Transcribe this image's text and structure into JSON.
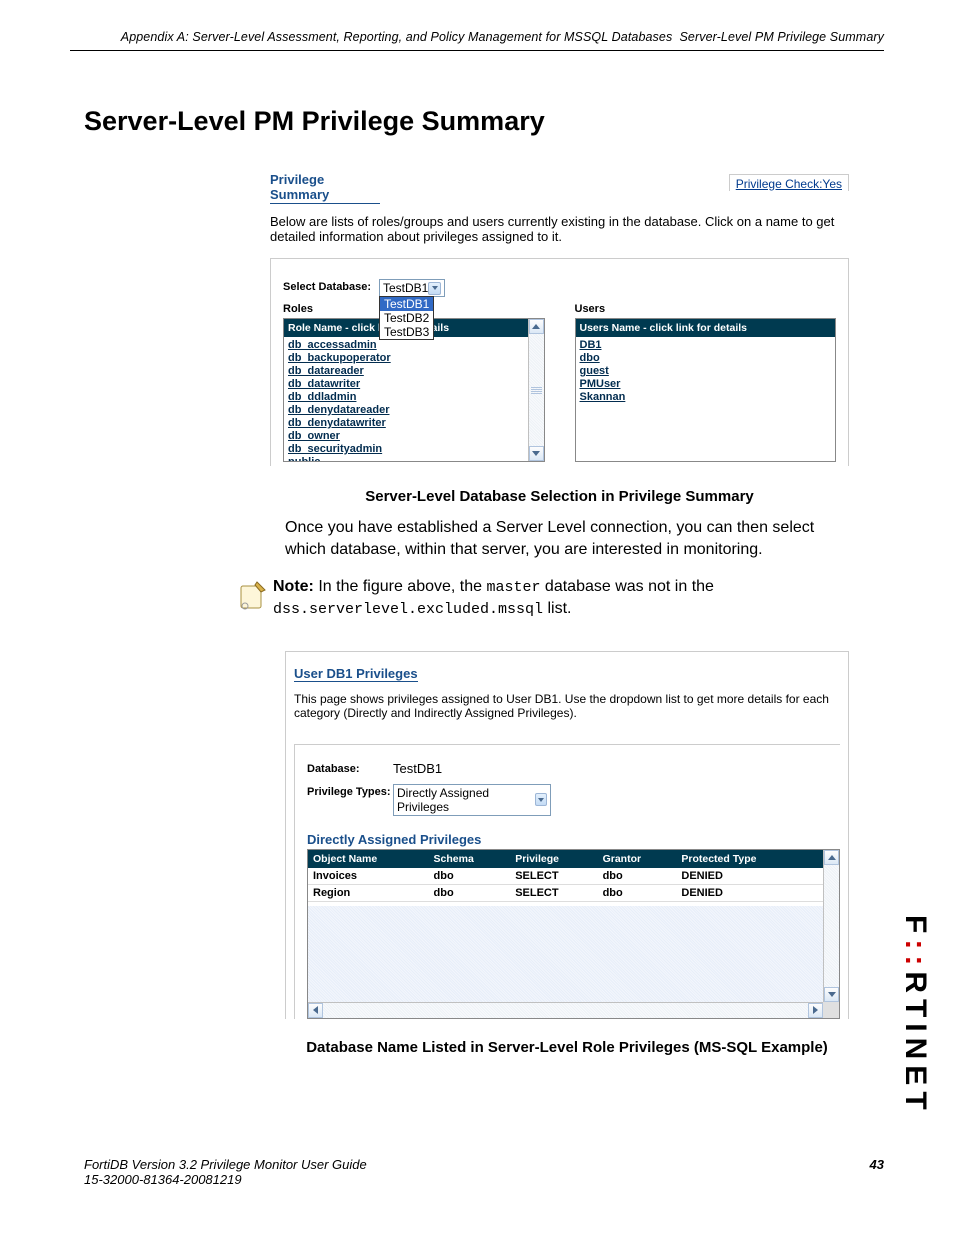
{
  "header": {
    "left": "Appendix A: Server-Level Assessment, Reporting, and Policy Management for MSSQL Databases",
    "right": "Server-Level PM Privilege Summary"
  },
  "title": "Server-Level PM Privilege Summary",
  "figure1": {
    "heading": "Privilege Summary",
    "priv_check": "Privilege Check:Yes",
    "intro": "Below are lists of roles/groups and users currently existing in the database. Click on a name to get detailed information about privileges assigned to it.",
    "select_label": "Select Database:",
    "select_value": "TestDB1",
    "select_options": [
      "TestDB1",
      "TestDB2",
      "TestDB3"
    ],
    "roles_label": "Roles",
    "users_label": "Users",
    "roles_header": "Role Name  - click link for details",
    "users_header": "Users Name - click link for details",
    "roles": [
      "db_accessadmin",
      "db_backupoperator",
      "db_datareader",
      "db_datawriter",
      "db_ddladmin",
      "db_denydatareader",
      "db_denydatawriter",
      "db_owner",
      "db_securityadmin",
      "public"
    ],
    "users": [
      "DB1",
      "dbo",
      "guest",
      "PMUser",
      "Skannan"
    ]
  },
  "caption1": "Server-Level Database Selection in Privilege Summary",
  "para1": "Once you have established a Server Level connection, you can then select which database, within that server, you are interested in monitoring.",
  "note": {
    "label": "Note:",
    "text1": "In the figure above, the ",
    "code1": "master",
    "text2": " database was not in the ",
    "code2": "dss.serverlevel.excluded.mssql",
    "text3": " list."
  },
  "figure2": {
    "heading": "User DB1 Privileges",
    "desc": "This page shows privileges assigned to User DB1. Use the dropdown list to get more details for each category (Directly and Indirectly Assigned Privileges).",
    "db_label": "Database:",
    "db_value": "TestDB1",
    "type_label": "Privilege Types:",
    "type_value": "Directly Assigned Privileges",
    "subheading": "Directly Assigned Privileges",
    "columns": [
      "Object Name",
      "Schema",
      "Privilege",
      "Grantor",
      "Protected Type"
    ],
    "rows": [
      [
        "Invoices",
        "dbo",
        "SELECT",
        "dbo",
        "DENIED"
      ],
      [
        "Region",
        "dbo",
        "SELECT",
        "dbo",
        "DENIED"
      ]
    ]
  },
  "caption2": "Database Name Listed in Server-Level Role Privileges (MS-SQL Example)",
  "footer": {
    "line1": "FortiDB Version 3.2 Privilege Monitor  User Guide",
    "line2": "15-32000-81364-20081219",
    "page": "43"
  },
  "logo": "FORTINET"
}
